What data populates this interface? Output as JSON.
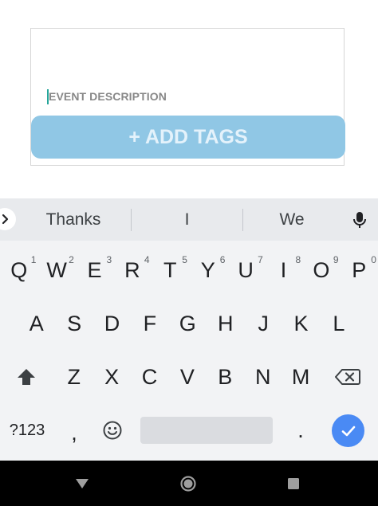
{
  "form": {
    "description_placeholder": "EVENT DESCRIPTION",
    "add_tags_label": "+ ADD TAGS"
  },
  "keyboard": {
    "suggestions": [
      "Thanks",
      "I",
      "We"
    ],
    "row1": [
      {
        "key": "Q",
        "hint": "1"
      },
      {
        "key": "W",
        "hint": "2"
      },
      {
        "key": "E",
        "hint": "3"
      },
      {
        "key": "R",
        "hint": "4"
      },
      {
        "key": "T",
        "hint": "5"
      },
      {
        "key": "Y",
        "hint": "6"
      },
      {
        "key": "U",
        "hint": "7"
      },
      {
        "key": "I",
        "hint": "8"
      },
      {
        "key": "O",
        "hint": "9"
      },
      {
        "key": "P",
        "hint": "0"
      }
    ],
    "row2": [
      "A",
      "S",
      "D",
      "F",
      "G",
      "H",
      "J",
      "K",
      "L"
    ],
    "row3": [
      "Z",
      "X",
      "C",
      "V",
      "B",
      "N",
      "M"
    ],
    "symbols_label": "?123",
    "comma_label": ",",
    "period_label": ".",
    "icons": {
      "expand": "chevron-right-icon",
      "mic": "microphone-icon",
      "shift": "shift-icon",
      "backspace": "backspace-icon",
      "emoji": "emoji-icon",
      "enter": "checkmark-icon"
    },
    "colors": {
      "enter_bg": "#4a8af4",
      "background": "#f2f3f5"
    }
  },
  "navbar": {
    "icons": [
      "back-icon",
      "home-icon",
      "recents-icon"
    ]
  },
  "colors": {
    "add_tags_bg": "#90c7e5",
    "caret": "#26a69a"
  }
}
